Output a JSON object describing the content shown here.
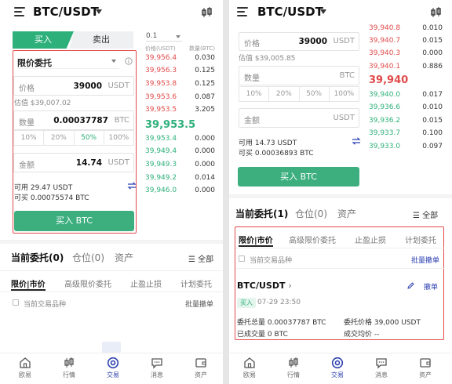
{
  "left": {
    "header": {
      "pair": "BTC/USDT"
    },
    "tabs": {
      "buy": "买入",
      "sell": "卖出"
    },
    "order_type": "限价委托",
    "price": {
      "label": "价格",
      "value": "39000",
      "unit": "USDT",
      "estimate": "估值 $39,007.02"
    },
    "amount": {
      "label": "数量",
      "value": "0.00037787",
      "unit": "BTC"
    },
    "pct": [
      "10%",
      "20%",
      "50%",
      "100%"
    ],
    "pct_active": 2,
    "total": {
      "label": "金额",
      "value": "14.74",
      "unit": "USDT"
    },
    "available": "可用 29.47 USDT",
    "can_buy": "可买 0.00075574 BTC",
    "buy_button": "买入 BTC",
    "orderbook": {
      "precision": "0.1",
      "col_price": "价格(USDT)",
      "col_qty": "数量(BTC)",
      "asks": [
        {
          "p": "39,956.4",
          "q": "0.030"
        },
        {
          "p": "39,956.3",
          "q": "0.125"
        },
        {
          "p": "39,953.8",
          "q": "0.125"
        },
        {
          "p": "39,953.6",
          "q": "0.087"
        },
        {
          "p": "39,953.5",
          "q": "3.205"
        }
      ],
      "last": "39,953.5",
      "bids": [
        {
          "p": "39,953.4",
          "q": "0.000"
        },
        {
          "p": "39,949.4",
          "q": "0.000"
        },
        {
          "p": "39,949.3",
          "q": "0.000"
        },
        {
          "p": "39,949.2",
          "q": "0.014"
        },
        {
          "p": "39,946.0",
          "q": "0.000"
        }
      ]
    },
    "orders": {
      "tab_current": "当前委托(0)",
      "tab_position": "仓位(0)",
      "tab_assets": "资产",
      "all": "全部",
      "sub": [
        "限价|市价",
        "高级限价委托",
        "止盈止损",
        "计划委托"
      ],
      "only_current": "当前交易品种",
      "cancel_all": "批量撤单"
    }
  },
  "right": {
    "header": {
      "pair": "BTC/USDT"
    },
    "price": {
      "label": "价格",
      "value": "39000",
      "unit": "USDT",
      "estimate": "估值 $39,005.85"
    },
    "amount": {
      "label": "数量",
      "unit": "BTC"
    },
    "pct": [
      "10%",
      "20%",
      "50%",
      "100%"
    ],
    "total": {
      "label": "金额",
      "unit": "USDT"
    },
    "available": "可用 14.73 USDT",
    "can_buy": "可买 0.00036893 BTC",
    "buy_button": "买入 BTC",
    "orderbook": {
      "asks": [
        {
          "p": "39,940.8",
          "q": "0.010"
        },
        {
          "p": "39,940.7",
          "q": "0.015"
        },
        {
          "p": "39,940.3",
          "q": "0.000"
        },
        {
          "p": "39,940.1",
          "q": "0.886"
        }
      ],
      "last": "39,940",
      "bids": [
        {
          "p": "39,940.0",
          "q": "0.017"
        },
        {
          "p": "39,936.6",
          "q": "0.010"
        },
        {
          "p": "39,936.2",
          "q": "0.015"
        },
        {
          "p": "39,933.7",
          "q": "0.100"
        },
        {
          "p": "39,933.0",
          "q": "0.097"
        }
      ]
    },
    "orders": {
      "tab_current": "当前委托(1)",
      "tab_position": "仓位(0)",
      "tab_assets": "资产",
      "all": "全部",
      "sub": [
        "限价|市价",
        "高级限价委托",
        "止盈止损",
        "计划委托"
      ],
      "only_current": "当前交易品种",
      "cancel_all": "批量撤单",
      "order": {
        "pair": "BTC/USDT",
        "cancel": "撤单",
        "side": "买入",
        "time": "07-29 23:50",
        "total_amount": "委托总量 0.00037787 BTC",
        "price": "委托价格 39,000 USDT",
        "filled": "已成交量 0 BTC",
        "avg": "成交均价 --"
      }
    }
  },
  "nav": [
    "欧易",
    "行情",
    "交易",
    "消息",
    "资产"
  ],
  "colors": {
    "green": "#2db07a",
    "red": "#e24a4a",
    "nav_active": "#2b3fb0"
  }
}
